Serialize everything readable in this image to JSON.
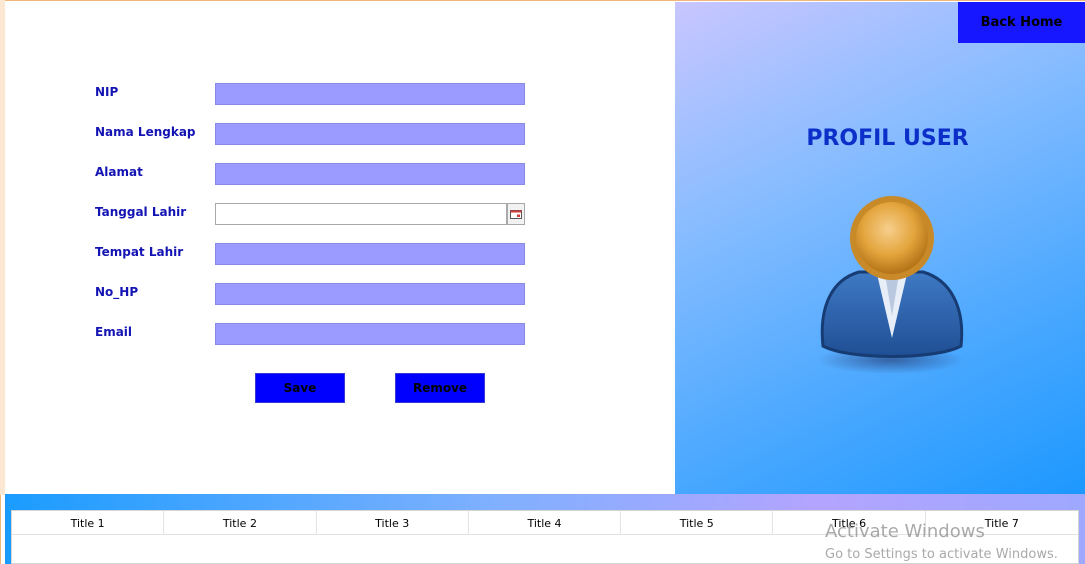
{
  "form": {
    "fields": [
      {
        "label": "NIP",
        "value": ""
      },
      {
        "label": "Nama Lengkap",
        "value": ""
      },
      {
        "label": "Alamat",
        "value": ""
      },
      {
        "label": "Tanggal Lahir",
        "value": ""
      },
      {
        "label": "Tempat Lahir",
        "value": ""
      },
      {
        "label": "No_HP",
        "value": ""
      },
      {
        "label": "Email",
        "value": ""
      }
    ],
    "save_label": "Save",
    "remove_label": "Remove",
    "calendar_icon": "calendar-icon"
  },
  "profile": {
    "back_label": "Back Home",
    "title": "PROFIL USER",
    "avatar_icon": "user-avatar-icon"
  },
  "table": {
    "columns": [
      "Title 1",
      "Title 2",
      "Title 3",
      "Title 4",
      "Title 5",
      "Title 6",
      "Title 7"
    ]
  },
  "watermark": {
    "title": "Activate Windows",
    "subtitle": "Go to Settings to activate Windows."
  },
  "colors": {
    "label_text": "#1414b4",
    "input_fill": "#9b9bff",
    "button_fill": "#0000ff",
    "title_text": "#0b2fc8"
  }
}
